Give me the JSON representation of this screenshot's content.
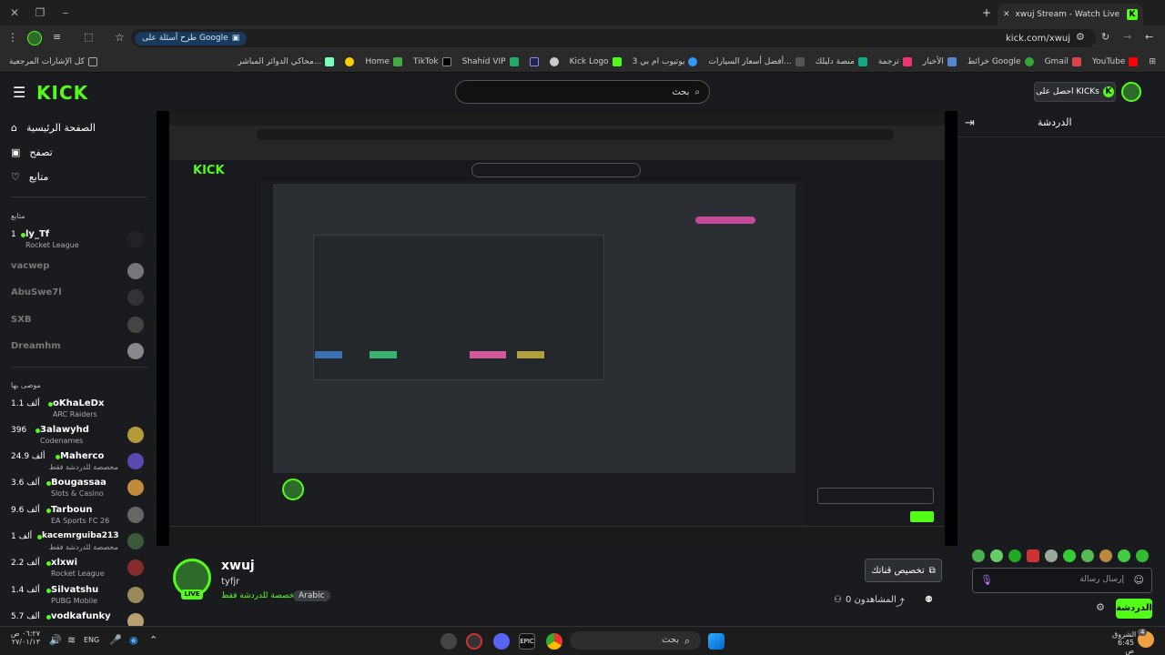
{
  "browser": {
    "tab_title": "xwuj Stream - Watch Live on Kick",
    "url": "kick.com/xwuj",
    "google_chip": "طرح أسئلة على Google",
    "bookmarks": [
      "YouTube",
      "Gmail",
      "خرائط Google",
      "الأخبار",
      "ترجمة",
      "منصة دليلك",
      "أفضل أسعار السيارات...",
      "يوتيوب ام بي 3",
      "Kick Logo",
      "Shahid VIP",
      "TikTok",
      "Home",
      "محاكي الدوائر المباشر...",
      "كل الإشارات المرجعية"
    ]
  },
  "header": {
    "logo": "KICK",
    "search_placeholder": "بحث",
    "get_kicks": "احصل على KICKs"
  },
  "sidebar": {
    "nav": [
      {
        "label": "الصفحة الرئيسية",
        "icon": "home-icon"
      },
      {
        "label": "تصفح",
        "icon": "browse-icon"
      },
      {
        "label": "متابع",
        "icon": "heart-icon"
      }
    ],
    "following_title": "متابع",
    "following": [
      {
        "name": "ly_Tf",
        "count": "1",
        "category": "Rocket League",
        "live": true
      },
      {
        "name": "vacwep",
        "count": "",
        "category": "",
        "live": false
      },
      {
        "name": "AbuSwe7l",
        "count": "",
        "category": "",
        "live": false
      },
      {
        "name": "SXB",
        "count": "",
        "category": "",
        "live": false
      },
      {
        "name": "Dreamhm",
        "count": "",
        "category": "",
        "live": false
      }
    ],
    "recommended_title": "موصى بها",
    "recommended": [
      {
        "name": "oKhaLeDx",
        "count": "1.1 ألف",
        "category": "ARC Raiders"
      },
      {
        "name": "3alawyhd",
        "count": "396",
        "category": "Codenames"
      },
      {
        "name": "Maherco",
        "count": "24.9 ألف",
        "category": "مخصصة للدردشة فقط"
      },
      {
        "name": "Bougassaa",
        "count": "3.6 ألف",
        "category": "Slots & Casino"
      },
      {
        "name": "Tarboun",
        "count": "9.6 ألف",
        "category": "EA Sports FC 26"
      },
      {
        "name": "kacemrguiba213",
        "count": "1 ألف",
        "category": "مخصصة للدردشة فقط"
      },
      {
        "name": "xlxwi",
        "count": "2.2 ألف",
        "category": "Rocket League"
      },
      {
        "name": "Silvatshu",
        "count": "1.4 ألف",
        "category": "PUBG Mobile"
      },
      {
        "name": "vodkafunky",
        "count": "5.7 ألف",
        "category": ""
      }
    ]
  },
  "stream": {
    "username": "xwuj",
    "title": "tyfjr",
    "category": "مخصصة للدردشة فقط",
    "tag": "Arabic",
    "live_badge": "LIVE",
    "viewers": "0 المشاهدون",
    "customize": "تخصيص قناتك"
  },
  "chat": {
    "title": "الدردشة",
    "placeholder": "إرسال رسالة",
    "send": "الدردشة"
  },
  "taskbar": {
    "search": "بحث",
    "lang": "ENG",
    "time": "٠٦:٢٧ ص",
    "date": "٢٧/٠١/١٣",
    "weather_label": "الشروق",
    "weather_time": "6:45 ص",
    "notif": "4"
  },
  "colors": {
    "accent": "#53fc18",
    "bg": "#191b1f",
    "video_bg": "#000000"
  }
}
